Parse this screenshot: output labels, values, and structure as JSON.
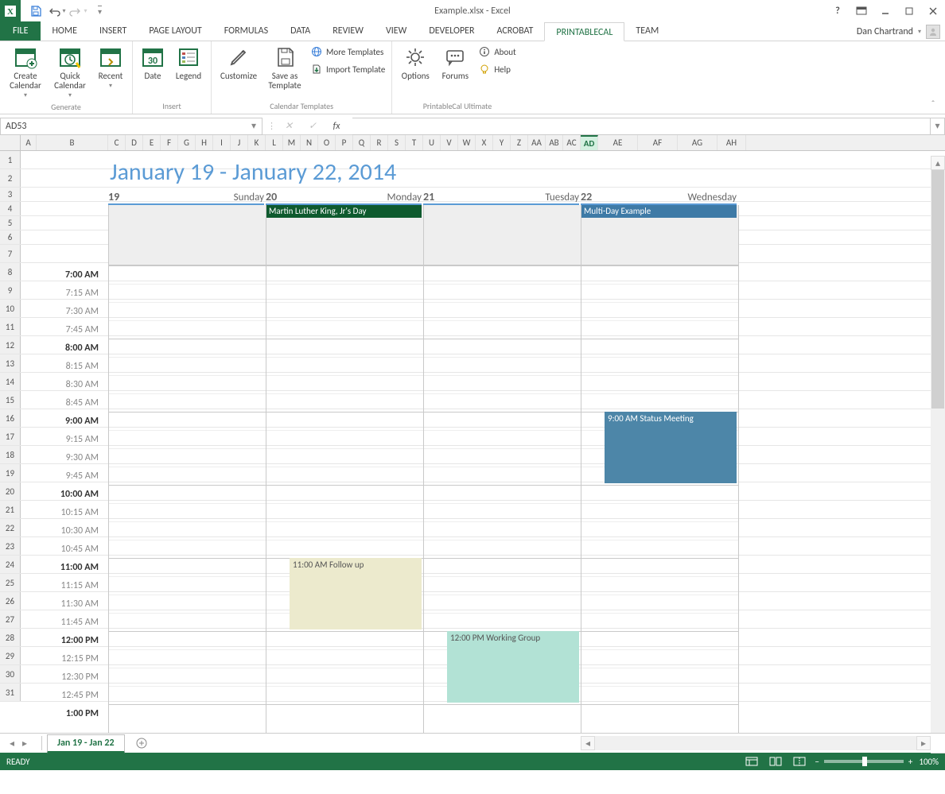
{
  "app": {
    "title": "Example.xlsx - Excel",
    "user": "Dan Chartrand"
  },
  "qat": {
    "save": "Save",
    "undo": "Undo",
    "redo": "Redo"
  },
  "tabs": {
    "file": "FILE",
    "items": [
      "HOME",
      "INSERT",
      "PAGE LAYOUT",
      "FORMULAS",
      "DATA",
      "REVIEW",
      "VIEW",
      "DEVELOPER",
      "ACROBAT",
      "PRINTABLECAL",
      "TEAM"
    ],
    "active": "PRINTABLECAL"
  },
  "ribbon": {
    "groups": {
      "generate": {
        "label": "Generate",
        "create": "Create Calendar",
        "quick": "Quick Calendar",
        "recent": "Recent"
      },
      "insert": {
        "label": "Insert",
        "date": "Date",
        "legend": "Legend"
      },
      "templates": {
        "label": "Calendar Templates",
        "customize": "Customize",
        "saveas": "Save as Template",
        "more": "More Templates",
        "import": "Import Template"
      },
      "ultimate": {
        "label": "PrintableCal Ultimate",
        "options": "Options",
        "forums": "Forums",
        "about": "About",
        "help": "Help"
      }
    }
  },
  "fbar": {
    "namebox": "AD53",
    "fx": "fx"
  },
  "columns": [
    "A",
    "B",
    "C",
    "D",
    "E",
    "F",
    "G",
    "H",
    "I",
    "J",
    "K",
    "L",
    "M",
    "N",
    "O",
    "P",
    "Q",
    "R",
    "S",
    "T",
    "U",
    "V",
    "W",
    "X",
    "Y",
    "Z",
    "AA",
    "AB",
    "AC",
    "AD",
    "AE",
    "AF",
    "AG",
    "AH"
  ],
  "col_widths": {
    "A": 20,
    "B_to_end_first": 90,
    "narrow": 22
  },
  "active_col": "AD",
  "row_headers": [
    "1",
    "2",
    "3",
    "4",
    "5",
    "6",
    "7",
    "8",
    "9",
    "10",
    "11",
    "12",
    "13",
    "14",
    "15",
    "16",
    "17",
    "18",
    "19",
    "20",
    "21",
    "22",
    "23",
    "24",
    "25",
    "26",
    "27",
    "28",
    "29",
    "30",
    "31"
  ],
  "calendar": {
    "title": "January 19 - January 22, 2014",
    "days": [
      {
        "num": "19",
        "name": "Sunday"
      },
      {
        "num": "20",
        "name": "Monday"
      },
      {
        "num": "21",
        "name": "Tuesday"
      },
      {
        "num": "22",
        "name": "Wednesday"
      }
    ],
    "times": [
      "7:00 AM",
      "7:15 AM",
      "7:30 AM",
      "7:45 AM",
      "8:00 AM",
      "8:15 AM",
      "8:30 AM",
      "8:45 AM",
      "9:00 AM",
      "9:15 AM",
      "9:30 AM",
      "9:45 AM",
      "10:00 AM",
      "10:15 AM",
      "10:30 AM",
      "10:45 AM",
      "11:00 AM",
      "11:15 AM",
      "11:30 AM",
      "11:45 AM",
      "12:00 PM",
      "12:15 PM",
      "12:30 PM",
      "12:45 PM",
      "1:00 PM"
    ],
    "hour_indices": [
      0,
      4,
      8,
      12,
      16,
      20,
      24
    ],
    "allday_events": [
      {
        "day": 1,
        "label": "Martin Luther King, Jr's Day",
        "bg": "#0e5a2e",
        "fg": "#ffffff"
      },
      {
        "day": 3,
        "label": "Multi-Day Example",
        "bg": "#3e7aa6",
        "fg": "#ffffff"
      }
    ],
    "events": [
      {
        "day": 3,
        "start_idx": 8,
        "end_idx": 12,
        "label": "9:00 AM  Status Meeting",
        "bg": "#4d86a8",
        "fg": "#ffffff",
        "inset": true
      },
      {
        "day": 1,
        "start_idx": 16,
        "end_idx": 20,
        "label": "11:00 AM  Follow up",
        "bg": "#eceacd",
        "fg": "#555",
        "offset": 30
      },
      {
        "day": 2,
        "start_idx": 20,
        "end_idx": 24,
        "label": "12:00 PM  Working Group",
        "bg": "#b2e2d5",
        "fg": "#555",
        "offset": 30
      }
    ]
  },
  "sheet_tabs": {
    "active": "Jan 19 - Jan 22"
  },
  "status": {
    "ready": "READY",
    "zoom": "100%"
  },
  "icons": {
    "minus": "−",
    "plus": "+",
    "chev_down": "▾",
    "chev_left": "◂",
    "chev_right": "▸",
    "chev_up": "▴",
    "x": "✕",
    "check": "✓",
    "dots": "⋮",
    "circle_plus": "⊕"
  }
}
